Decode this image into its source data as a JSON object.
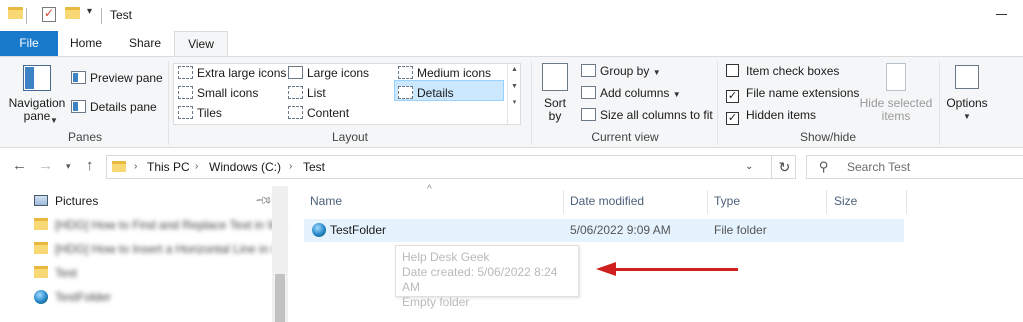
{
  "window": {
    "title": "Test"
  },
  "ribbon_tabs": {
    "file": "File",
    "home": "Home",
    "share": "Share",
    "view": "View"
  },
  "panes": {
    "navigation_pane": "Navigation\npane",
    "preview_pane": "Preview pane",
    "details_pane": "Details pane",
    "label": "Panes"
  },
  "layout": {
    "extra_large_icons": "Extra large icons",
    "large_icons": "Large icons",
    "medium_icons": "Medium icons",
    "small_icons": "Small icons",
    "list": "List",
    "details": "Details",
    "tiles": "Tiles",
    "content": "Content",
    "label": "Layout",
    "selected": "Details"
  },
  "current_view": {
    "sort_by": "Sort\nby",
    "group_by": "Group by",
    "add_columns": "Add columns",
    "size_all_columns": "Size all columns to fit",
    "label": "Current view"
  },
  "show_hide": {
    "item_check_boxes": "Item check boxes",
    "item_check_boxes_checked": false,
    "file_name_extensions": "File name extensions",
    "file_name_extensions_checked": true,
    "hidden_items": "Hidden items",
    "hidden_items_checked": true,
    "hide_selected_items": "Hide selected\nitems",
    "label": "Show/hide"
  },
  "options": {
    "label": "Options"
  },
  "address_bar": {
    "breadcrumbs": [
      "This PC",
      "Windows (C:)",
      "Test"
    ]
  },
  "search": {
    "placeholder": "Search Test"
  },
  "navigation_pane": {
    "items": [
      {
        "label": "Pictures",
        "icon": "pictures-icon",
        "pinned": true
      },
      {
        "label": "[HDG] How to Find and Replace Text in Wo",
        "icon": "folder-icon",
        "blurred": true,
        "pinned": true
      },
      {
        "label": "[HDG] How to Insert a Horizontal Line in G",
        "icon": "folder-icon",
        "blurred": true
      },
      {
        "label": "Test",
        "icon": "folder-icon",
        "blurred": true
      },
      {
        "label": "TestFolder",
        "icon": "globe-folder-icon",
        "blurred": true
      }
    ]
  },
  "columns": {
    "name": "Name",
    "date_modified": "Date modified",
    "type": "Type",
    "size": "Size"
  },
  "files": [
    {
      "name": "TestFolder",
      "date_modified": "5/06/2022 9:09 AM",
      "type": "File folder",
      "size": ""
    }
  ],
  "tooltip": {
    "line1": "Help Desk Geek",
    "line2": "Date created: 5/06/2022 8:24 AM",
    "line3": "Empty folder"
  },
  "annotation": {
    "arrow_color": "#d01f1f"
  },
  "colors": {
    "accent": "#1979ca",
    "selection": "#cce8ff",
    "row_hover": "#e5f3ff"
  }
}
